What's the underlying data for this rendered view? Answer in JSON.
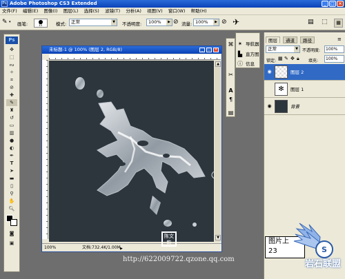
{
  "app": {
    "title": "Adobe Photoshop CS3 Extended",
    "icon_text": "Ps"
  },
  "menu": [
    "文件(F)",
    "编辑(E)",
    "图像(I)",
    "图层(L)",
    "选择(S)",
    "滤镜(T)",
    "分析(A)",
    "视图(V)",
    "窗口(W)",
    "帮助(H)"
  ],
  "options": {
    "brush_label": "画笔:",
    "brush_size": "15",
    "mode_label": "模式:",
    "mode_value": "正常",
    "opacity_label": "不透明度:",
    "opacity_value": "100%",
    "flow_label": "流量:",
    "flow_value": "100%"
  },
  "toolbox": {
    "logo": "Ps"
  },
  "document": {
    "title": "未标题-1 @ 100% (图层 2, RGB/8)",
    "zoom": "100%",
    "doc_size": "文档:732.4K/1.00M"
  },
  "mini_panel": {
    "items": [
      {
        "label": "导航器",
        "icon": "navigator-icon"
      },
      {
        "label": "直方图",
        "icon": "histogram-icon"
      },
      {
        "label": "信息",
        "icon": "info-icon"
      }
    ]
  },
  "layers_panel": {
    "tabs": [
      "图层",
      "通道",
      "路径"
    ],
    "blend_mode": "正常",
    "opacity_label": "不透明度:",
    "opacity_value": "100%",
    "lock_label": "锁定:",
    "fill_label": "填充:",
    "fill_value": "100%",
    "layers": [
      {
        "name": "图层 2",
        "selected": true
      },
      {
        "name": "图层 1",
        "selected": false
      },
      {
        "name": "背景",
        "selected": false
      }
    ]
  },
  "watermark": {
    "url": "http://622009722.qzone.qq.com",
    "stamp": "陈文韵",
    "popup_line1": "图片上",
    "popup_line2": "23",
    "logo_text": "岩石联盟"
  },
  "colors": {
    "titlebar": "#0b43b8",
    "canvas": "#2d353d",
    "workspace": "#6e6e6e",
    "panel": "#ece9d8",
    "selected_layer": "#316ac5"
  }
}
